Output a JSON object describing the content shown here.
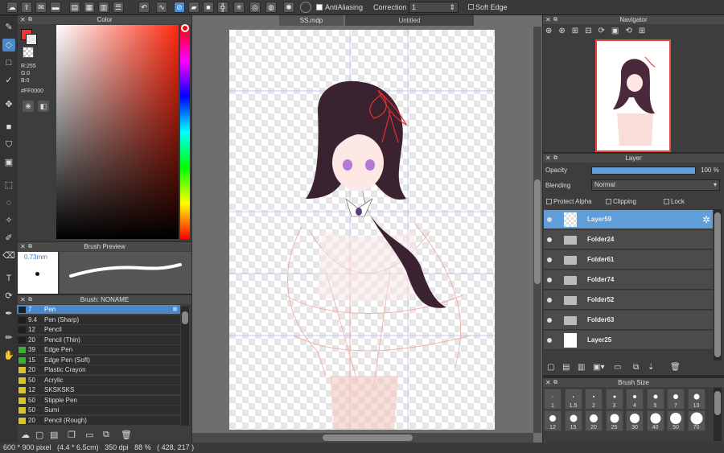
{
  "toolbar": {
    "antialias_label": "AntiAliasing",
    "correction_label": "Correction",
    "correction_value": "1",
    "soft_edge_label": "Soft Edge"
  },
  "tabs": [
    {
      "label": "SS.mdp"
    },
    {
      "label": "Untitled"
    }
  ],
  "color": {
    "title": "Color",
    "r": "R:255",
    "g": "G:0",
    "b": "B:0",
    "hex": "#FF0000",
    "accent": "#ff0000"
  },
  "brush_preview": {
    "title": "Brush Preview",
    "size": "0.73mm"
  },
  "brush": {
    "title": "Brush: NONAME",
    "items": [
      {
        "size": "7",
        "name": "Pen",
        "color": "#1e1e1e"
      },
      {
        "size": "9.4",
        "name": "Pen (Sharp)",
        "color": "#1e1e1e"
      },
      {
        "size": "12",
        "name": "Pencil",
        "color": "#1e1e1e"
      },
      {
        "size": "20",
        "name": "Pencil (Thin)",
        "color": "#1e1e1e"
      },
      {
        "size": "39",
        "name": "Edge Pen",
        "color": "#3cb034"
      },
      {
        "size": "15",
        "name": "Edge Pen (Soft)",
        "color": "#3cb034"
      },
      {
        "size": "20",
        "name": "Plastic Crayon",
        "color": "#d9c52b"
      },
      {
        "size": "50",
        "name": "Acrylic",
        "color": "#d9c52b"
      },
      {
        "size": "12",
        "name": "SKSKSKS",
        "color": "#d9c52b"
      },
      {
        "size": "50",
        "name": "Stipple Pen",
        "color": "#d9c52b"
      },
      {
        "size": "50",
        "name": "Sumi",
        "color": "#d9c52b"
      },
      {
        "size": "20",
        "name": "Pencil (Rough)",
        "color": "#d9c52b"
      }
    ]
  },
  "navigator": {
    "title": "Navigator"
  },
  "layer": {
    "title": "Layer",
    "opacity_label": "Opacity",
    "opacity_value": "100 %",
    "opacity": 1.0,
    "blending_label": "Blending",
    "blending_value": "Normal",
    "protect_alpha": "Protect Alpha",
    "clipping": "Clipping",
    "lock": "Lock",
    "items": [
      {
        "name": "Layer59",
        "kind": "layer",
        "selected": true
      },
      {
        "name": "Folder24",
        "kind": "folder"
      },
      {
        "name": "Folder61",
        "kind": "folder"
      },
      {
        "name": "Folder74",
        "kind": "folder"
      },
      {
        "name": "Folder52",
        "kind": "folder"
      },
      {
        "name": "Folder63",
        "kind": "folder"
      },
      {
        "name": "Layer25",
        "kind": "layer"
      }
    ]
  },
  "brush_size": {
    "title": "Brush Size",
    "row1": [
      "1",
      "1.5",
      "2",
      "3",
      "4",
      "5",
      "7",
      "10"
    ],
    "row2": [
      "12",
      "15",
      "20",
      "25",
      "30",
      "40",
      "50",
      "70"
    ]
  },
  "status": {
    "text": "600 * 900 pixel   (4.4 * 6.5cm)   350 dpi   88 %   ( 428, 217 )"
  }
}
